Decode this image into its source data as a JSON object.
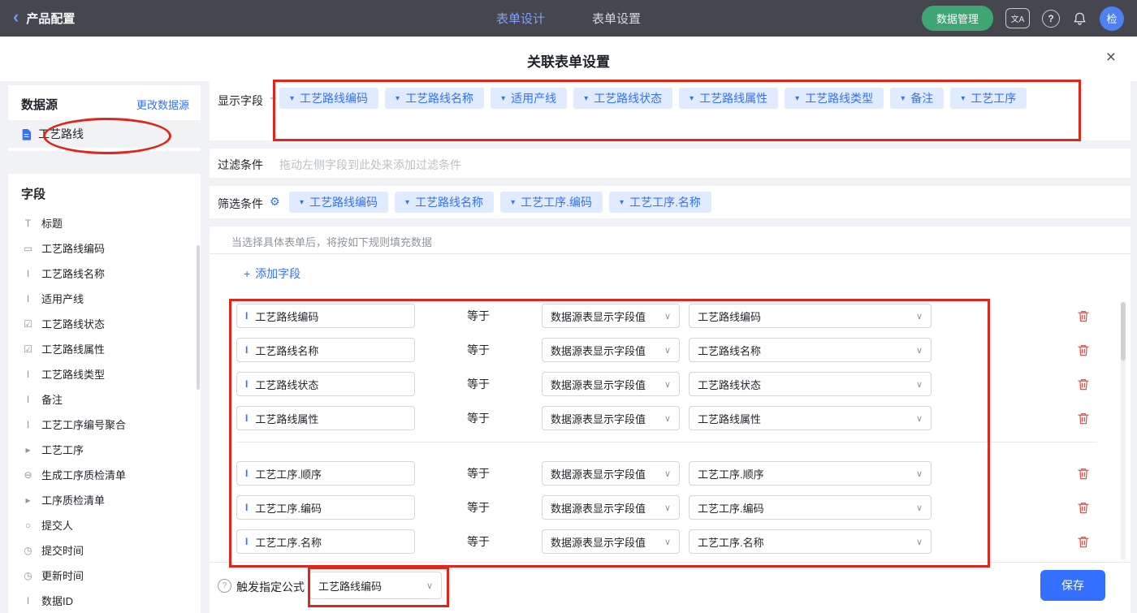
{
  "icons": {
    "back_chevron": "‹",
    "caret_down": "▾",
    "select_caret": "∨",
    "close": "×",
    "plus": "+",
    "gear": "⚙",
    "help": "?",
    "translate": "文A"
  },
  "colors": {
    "accent_blue": "#3370ff",
    "annotation_red": "#e0251a",
    "topbar_green": "#3fa673",
    "trash_red": "#f54a45"
  },
  "topbar": {
    "back_label": "产品配置",
    "tabs": [
      {
        "label": "表单设计",
        "active": true
      },
      {
        "label": "表单设置",
        "active": false
      }
    ],
    "data_manage_label": "数据管理",
    "avatar_text": "检"
  },
  "modal": {
    "title": "关联表单设置"
  },
  "sidebar": {
    "datasource": {
      "title": "数据源",
      "change_link": "更改数据源",
      "selected_item": "工艺路线"
    },
    "fields_panel": {
      "title": "字段",
      "items": [
        {
          "icon": "title-icon",
          "glyph": "T",
          "label": "标题"
        },
        {
          "icon": "input-icon",
          "glyph": "▭",
          "label": "工艺路线编码"
        },
        {
          "icon": "text-icon",
          "glyph": "I",
          "label": "工艺路线名称"
        },
        {
          "icon": "text-icon",
          "glyph": "I",
          "label": "适用产线"
        },
        {
          "icon": "select-icon",
          "glyph": "☑",
          "label": "工艺路线状态"
        },
        {
          "icon": "select-icon",
          "glyph": "☑",
          "label": "工艺路线属性"
        },
        {
          "icon": "text-icon",
          "glyph": "I",
          "label": "工艺路线类型"
        },
        {
          "icon": "text-icon",
          "glyph": "I",
          "label": "备注"
        },
        {
          "icon": "text-icon",
          "glyph": "I",
          "label": "工艺工序编号聚合"
        },
        {
          "icon": "subform-icon",
          "glyph": "▸",
          "label": "工艺工序"
        },
        {
          "icon": "generate-icon",
          "glyph": "⊖",
          "label": "生成工序质检清单"
        },
        {
          "icon": "subform-icon",
          "glyph": "▸",
          "label": "工序质检清单"
        },
        {
          "icon": "user-icon",
          "glyph": "○",
          "label": "提交人"
        },
        {
          "icon": "time-icon",
          "glyph": "◷",
          "label": "提交时间"
        },
        {
          "icon": "time-icon",
          "glyph": "◷",
          "label": "更新时间"
        },
        {
          "icon": "id-icon",
          "glyph": "I",
          "label": "数据ID"
        }
      ]
    }
  },
  "main": {
    "display_fields": {
      "label": "显示字段",
      "tags": [
        "工艺路线编码",
        "工艺路线名称",
        "适用产线",
        "工艺路线状态",
        "工艺路线属性",
        "工艺路线类型",
        "备注",
        "工艺工序"
      ]
    },
    "filter": {
      "label": "过滤条件",
      "placeholder": "拖动左侧字段到此处来添加过滤条件"
    },
    "screening": {
      "label": "筛选条件",
      "tags": [
        "工艺路线编码",
        "工艺路线名称",
        "工艺工序.编码",
        "工艺工序.名称"
      ]
    },
    "hint": "当选择具体表单后，将按如下规则填充数据",
    "add_field_label": "添加字段",
    "rules": [
      {
        "field": "工艺路线编码",
        "op": "等于",
        "source": "数据源表显示字段值",
        "value": "工艺路线编码",
        "group": 1
      },
      {
        "field": "工艺路线名称",
        "op": "等于",
        "source": "数据源表显示字段值",
        "value": "工艺路线名称",
        "group": 1
      },
      {
        "field": "工艺路线状态",
        "op": "等于",
        "source": "数据源表显示字段值",
        "value": "工艺路线状态",
        "group": 1
      },
      {
        "field": "工艺路线属性",
        "op": "等于",
        "source": "数据源表显示字段值",
        "value": "工艺路线属性",
        "group": 1
      },
      {
        "field": "工艺工序.顺序",
        "op": "等于",
        "source": "数据源表显示字段值",
        "value": "工艺工序.顺序",
        "group": 2
      },
      {
        "field": "工艺工序.编码",
        "op": "等于",
        "source": "数据源表显示字段值",
        "value": "工艺工序.编码",
        "group": 2
      },
      {
        "field": "工艺工序.名称",
        "op": "等于",
        "source": "数据源表显示字段值",
        "value": "工艺工序.名称",
        "group": 2
      }
    ],
    "trigger": {
      "label": "触发指定公式",
      "value": "工艺路线编码"
    },
    "save_label": "保存"
  }
}
